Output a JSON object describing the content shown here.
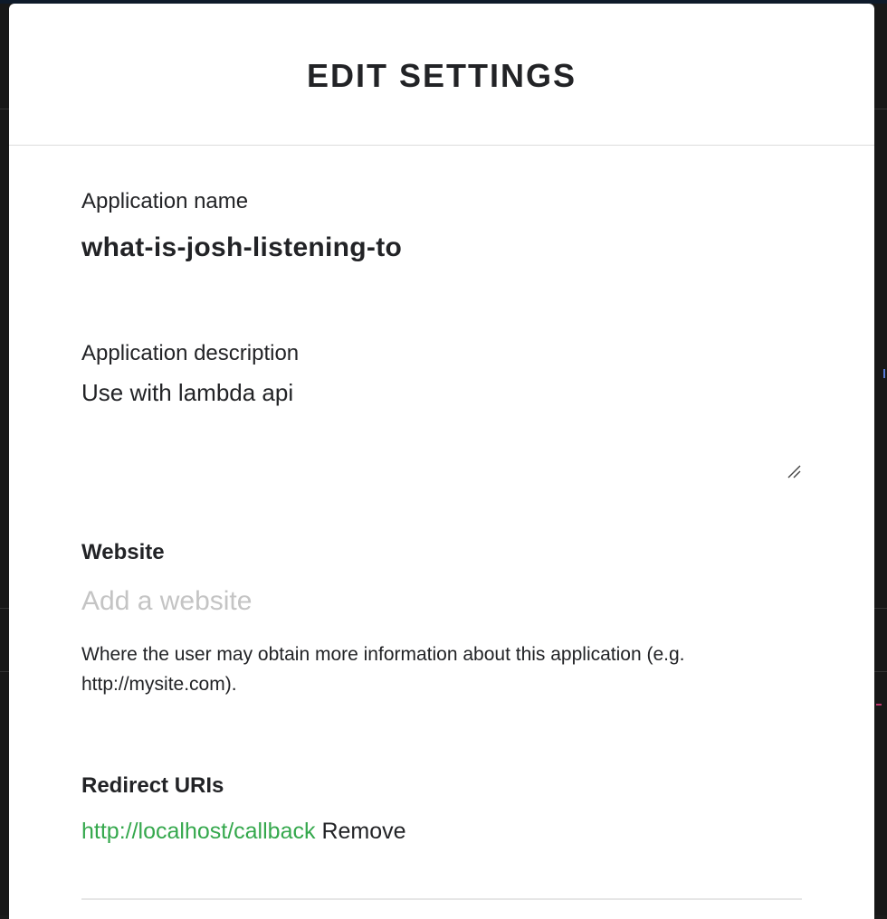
{
  "modal": {
    "title": "EDIT SETTINGS"
  },
  "application_name": {
    "label": "Application name",
    "value": "what-is-josh-listening-to"
  },
  "application_description": {
    "label": "Application description",
    "value": "Use with lambda api"
  },
  "website": {
    "label": "Website",
    "value": "",
    "placeholder": "Add a website",
    "helper": "Where the user may obtain more information about this application (e.g. http://mysite.com)."
  },
  "redirect_uris": {
    "label": "Redirect URIs",
    "items": [
      {
        "uri": "http://localhost/callback",
        "remove_label": "Remove"
      }
    ]
  },
  "colors": {
    "link_green": "#35a84d",
    "text": "#222326",
    "placeholder": "#c4c4c4",
    "divider": "#dcdcdc"
  }
}
